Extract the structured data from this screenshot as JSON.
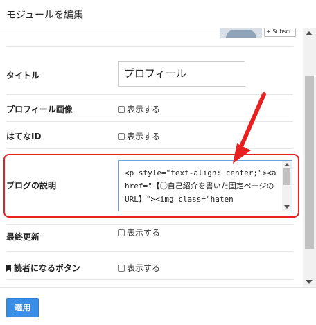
{
  "dialog": {
    "title": "モジュールを編集"
  },
  "preview": {
    "subscribe_label": "+ Subscri"
  },
  "fields": {
    "title": {
      "label": "タイトル",
      "value": "プロフィール"
    },
    "profile_image": {
      "label": "プロフィール画像",
      "option": "表示する"
    },
    "hatena_id": {
      "label": "はてなID",
      "option": "表示する"
    },
    "blog_description": {
      "label": "ブログの説明",
      "value": "<p style=\"text-align: center;\"><a href=\"【①自己紹介を書いた固定ページのURL】\"><img class=\"haten"
    },
    "last_updated": {
      "label": "最終更新",
      "option": "表示する"
    },
    "reader_button": {
      "label": "読者になるボタン",
      "option": "表示する"
    }
  },
  "footer": {
    "apply_label": "適用"
  },
  "colors": {
    "accent": "#3a8ee6",
    "highlight": "#e8201f"
  }
}
